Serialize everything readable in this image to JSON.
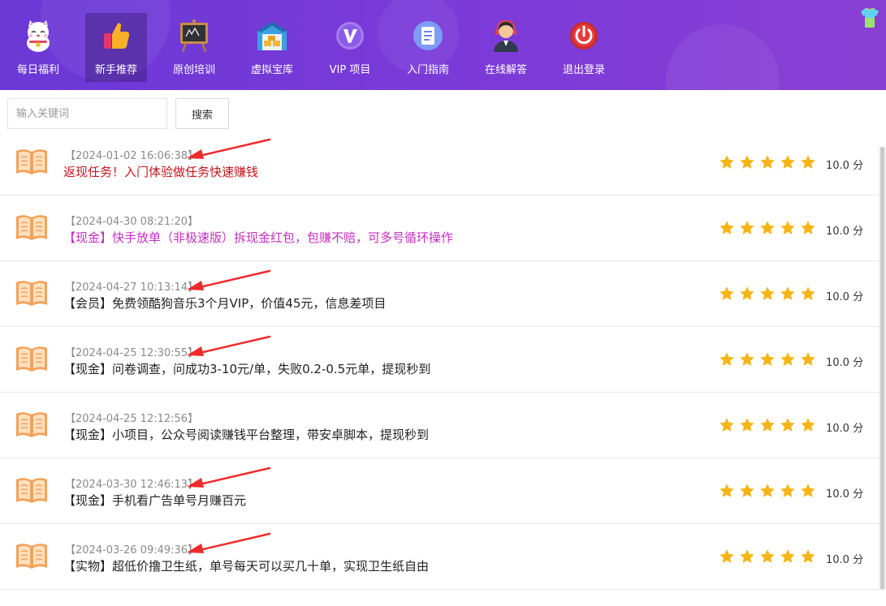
{
  "nav": {
    "items": [
      {
        "label": "每日福利",
        "icon": "lucky-cat-icon"
      },
      {
        "label": "新手推荐",
        "icon": "thumbs-up-icon",
        "active": true
      },
      {
        "label": "原创培训",
        "icon": "chalkboard-icon"
      },
      {
        "label": "虚拟宝库",
        "icon": "warehouse-icon"
      },
      {
        "label": "VIP 项目",
        "icon": "vip-icon"
      },
      {
        "label": "入门指南",
        "icon": "document-icon"
      },
      {
        "label": "在线解答",
        "icon": "support-agent-icon"
      },
      {
        "label": "退出登录",
        "icon": "power-icon"
      }
    ]
  },
  "search": {
    "placeholder": "输入关键词",
    "value": "",
    "button_label": "搜索"
  },
  "colors": {
    "nav_start": "#6b38d6",
    "nav_end": "#8a3fd4",
    "title_red": "#c4161c",
    "title_magenta": "#c52ec2",
    "title_default": "#222222",
    "star": "#f5b516",
    "arrow": "#ee2b2b"
  },
  "list": {
    "rows": [
      {
        "timestamp": "【2024-01-02 16:06:38】",
        "title": "返现任务！入门体验做任务快速赚钱",
        "title_color": "#c4161c",
        "stars": 5,
        "score": "10.0 分",
        "arrow": true
      },
      {
        "timestamp": "【2024-04-30 08:21:20】",
        "title": "【现金】快手放单（非极速版）拆现金红包，包赚不赔，可多号循环操作",
        "title_color": "#c52ec2",
        "stars": 5,
        "score": "10.0 分",
        "arrow": false
      },
      {
        "timestamp": "【2024-04-27 10:13:14】",
        "title": "【会员】免费领酷狗音乐3个月VIP，价值45元，信息差项目",
        "title_color": "#222222",
        "stars": 5,
        "score": "10.0 分",
        "arrow": true
      },
      {
        "timestamp": "【2024-04-25 12:30:55】",
        "title": "【现金】问卷调查，问成功3-10元/单，失败0.2-0.5元单，提现秒到",
        "title_color": "#222222",
        "stars": 5,
        "score": "10.0 分",
        "arrow": true
      },
      {
        "timestamp": "【2024-04-25 12:12:56】",
        "title": "【现金】小项目，公众号阅读赚钱平台整理，带安卓脚本，提现秒到",
        "title_color": "#222222",
        "stars": 5,
        "score": "10.0 分",
        "arrow": false
      },
      {
        "timestamp": "【2024-03-30 12:46:13】",
        "title": "【现金】手机看广告单号月赚百元",
        "title_color": "#222222",
        "stars": 5,
        "score": "10.0 分",
        "arrow": true
      },
      {
        "timestamp": "【2024-03-26 09:49:36】",
        "title": "【实物】超低价撸卫生纸，单号每天可以买几十单，实现卫生纸自由",
        "title_color": "#222222",
        "stars": 5,
        "score": "10.0 分",
        "arrow": true
      }
    ]
  }
}
